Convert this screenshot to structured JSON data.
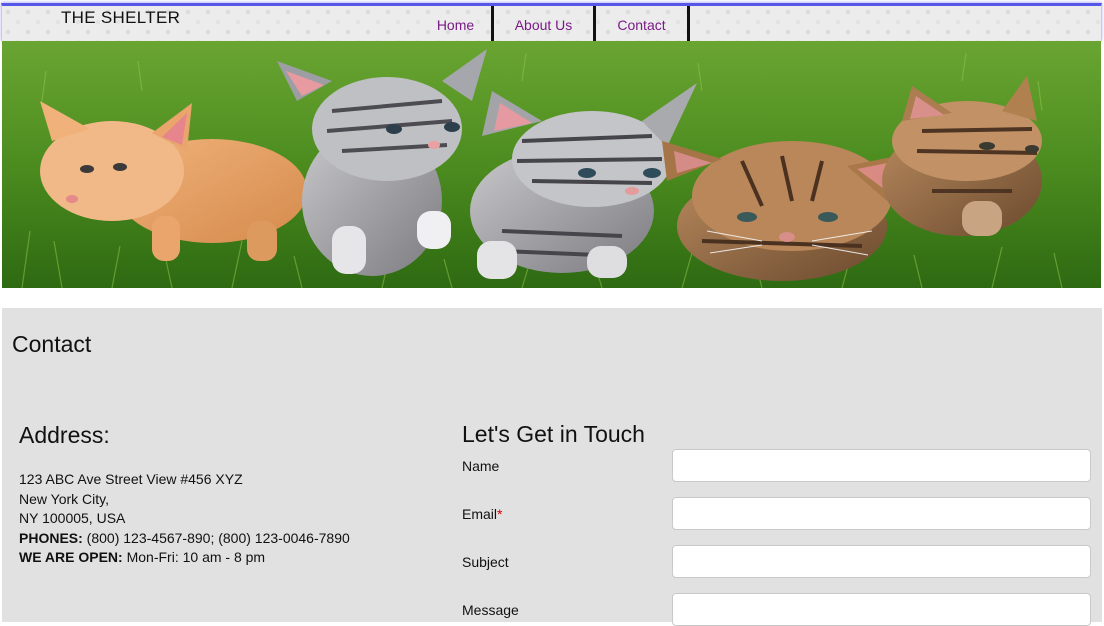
{
  "header": {
    "brand": "THE SHELTER",
    "nav": [
      {
        "label": "Home"
      },
      {
        "label": "About Us"
      },
      {
        "label": "Contact"
      }
    ]
  },
  "contact": {
    "title": "Contact",
    "address": {
      "heading": "Address:",
      "street": "123 ABC Ave Street View #456 XYZ",
      "city": "New York City,",
      "region": "NY 100005, USA",
      "phones_label": "PHONES:",
      "phones": " (800) 123-4567-890; (800) 123-0046-7890",
      "hours_label": "WE ARE OPEN:",
      "hours": " Mon-Fri: 10 am - 8 pm"
    },
    "form": {
      "heading": "Let's Get in Touch",
      "name_label": "Name",
      "name_value": "",
      "email_label": "Email",
      "email_required_mark": "*",
      "email_value": "",
      "subject_label": "Subject",
      "subject_value": "",
      "message_label": "Message",
      "message_value": ""
    }
  },
  "colors": {
    "header_accent": "#5656e8",
    "nav_link": "#7a1a86",
    "section_bg": "#e1e1e1",
    "required": "#d20000"
  }
}
